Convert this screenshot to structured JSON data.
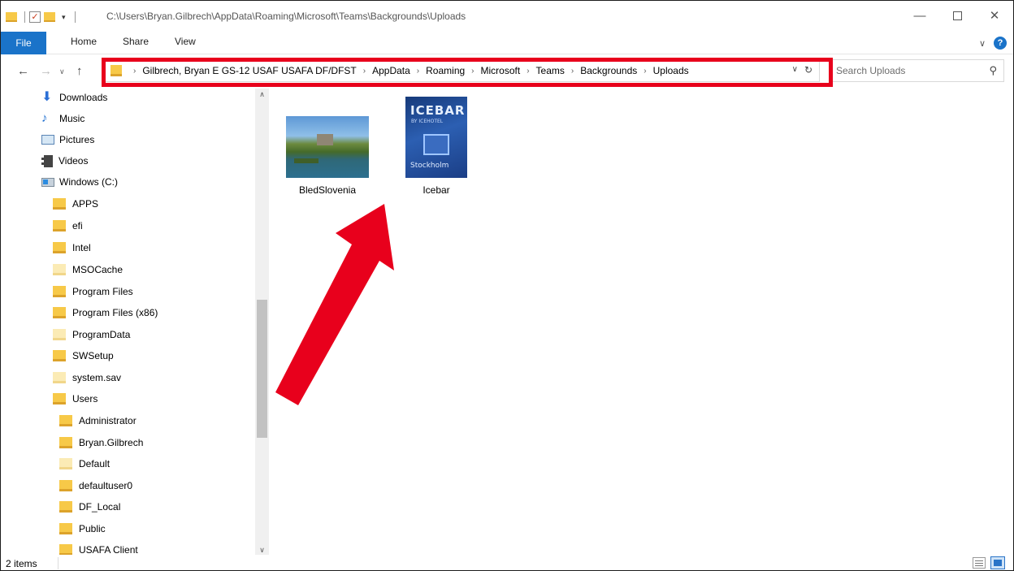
{
  "window": {
    "title": "C:\\Users\\Bryan.Gilbrech\\AppData\\Roaming\\Microsoft\\Teams\\Backgrounds\\Uploads",
    "controls": {
      "minimize": "—",
      "maximize": "",
      "close": "✕"
    }
  },
  "ribbon": {
    "tabs": {
      "file": "File",
      "home": "Home",
      "share": "Share",
      "view": "View"
    }
  },
  "navigation": {
    "back": "←",
    "forward": "→",
    "recent": "∨",
    "up": "↑",
    "breadcrumbs": [
      "Gilbrech, Bryan E GS-12 USAF USAFA DF/DFST",
      "AppData",
      "Roaming",
      "Microsoft",
      "Teams",
      "Backgrounds",
      "Uploads"
    ],
    "dropdown": "∨",
    "refresh": "↻"
  },
  "search": {
    "placeholder": "Search Uploads"
  },
  "sidebar": {
    "items": [
      {
        "label": "Downloads",
        "icon": "download-icon"
      },
      {
        "label": "Music",
        "icon": "music-icon"
      },
      {
        "label": "Pictures",
        "icon": "pictures-icon"
      },
      {
        "label": "Videos",
        "icon": "videos-icon"
      },
      {
        "label": "Windows (C:)",
        "icon": "drive-icon"
      },
      {
        "label": "APPS",
        "icon": "folder-icon"
      },
      {
        "label": "efi",
        "icon": "folder-icon"
      },
      {
        "label": "Intel",
        "icon": "folder-icon"
      },
      {
        "label": "MSOCache",
        "icon": "folder-icon"
      },
      {
        "label": "Program Files",
        "icon": "folder-icon"
      },
      {
        "label": "Program Files (x86)",
        "icon": "folder-icon"
      },
      {
        "label": "ProgramData",
        "icon": "folder-icon"
      },
      {
        "label": "SWSetup",
        "icon": "folder-icon"
      },
      {
        "label": "system.sav",
        "icon": "folder-icon"
      },
      {
        "label": "Users",
        "icon": "folder-icon"
      },
      {
        "label": "Administrator",
        "icon": "folder-icon"
      },
      {
        "label": "Bryan.Gilbrech",
        "icon": "folder-icon"
      },
      {
        "label": "Default",
        "icon": "folder-icon"
      },
      {
        "label": "defaultuser0",
        "icon": "folder-icon"
      },
      {
        "label": "DF_Local",
        "icon": "folder-icon"
      },
      {
        "label": "Public",
        "icon": "folder-icon"
      },
      {
        "label": "USAFA Client",
        "icon": "folder-icon"
      }
    ]
  },
  "files": [
    {
      "name": "BledSlovenia"
    },
    {
      "name": "Icebar",
      "thumb_text": {
        "title": "ICEBAR",
        "subtitle": "BY ICEHOTEL",
        "city": "Stockholm"
      }
    }
  ],
  "status": {
    "item_count": "2 items"
  },
  "colors": {
    "accent": "#1a73c9",
    "highlight": "#e8001c",
    "folder": "#f7c948"
  }
}
